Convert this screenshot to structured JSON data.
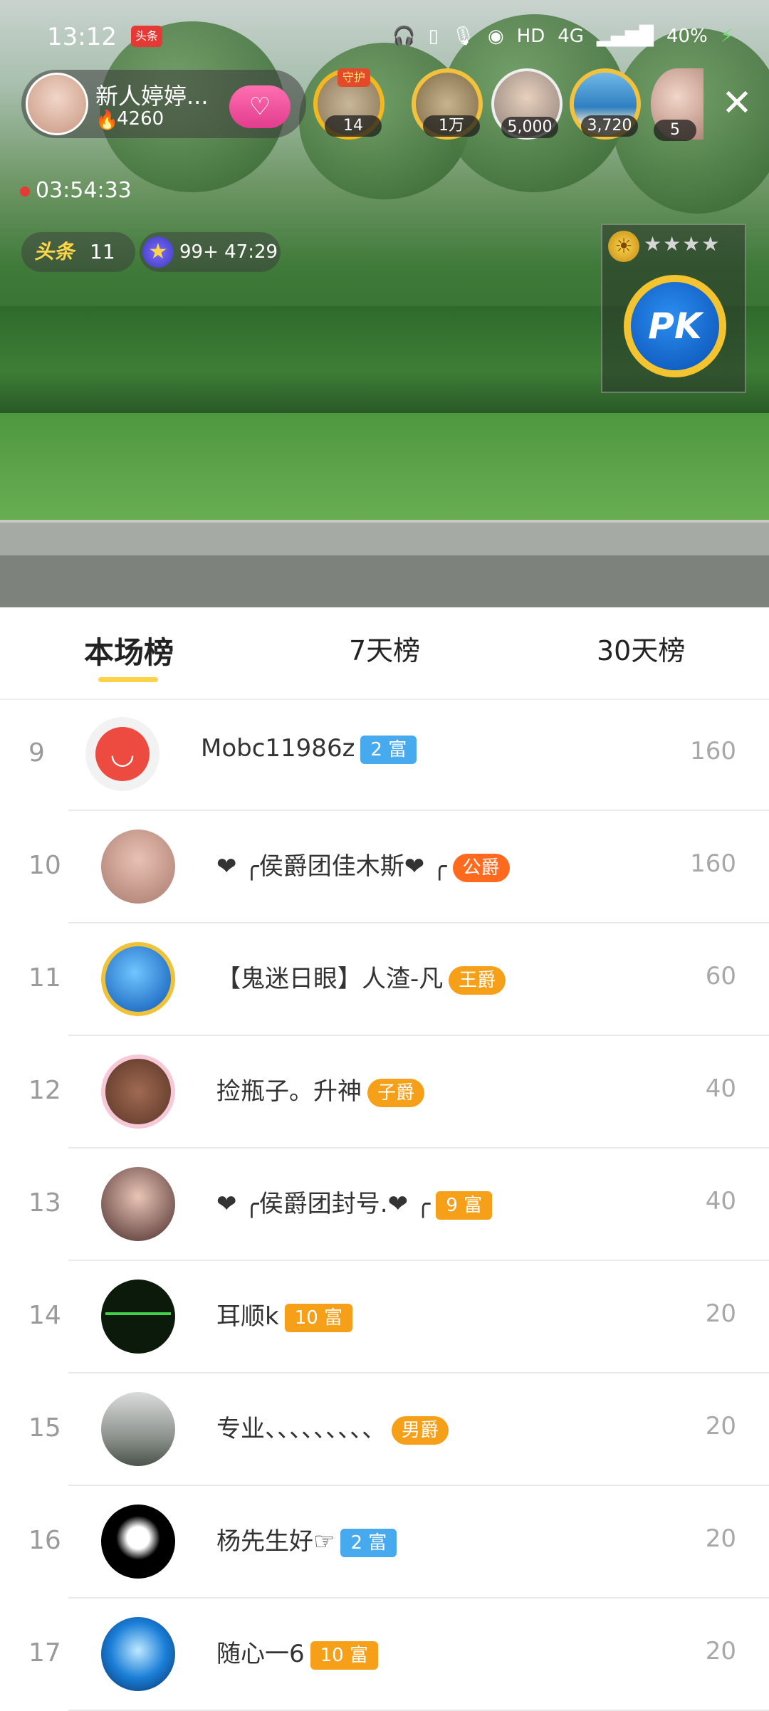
{
  "status_bar": {
    "time": "13:12",
    "news_badge": "头条",
    "network": "HD",
    "signal": "4G",
    "battery": "40%"
  },
  "host": {
    "name": "新人婷婷...",
    "score": "4260"
  },
  "viewers": [
    {
      "count": "14",
      "tag": "守护"
    },
    {
      "count": "1万"
    },
    {
      "count": "5,000"
    },
    {
      "count": "3,720"
    },
    {
      "count": "5"
    }
  ],
  "live": {
    "duration": "03:54:33"
  },
  "headline_rank": {
    "logo": "头条",
    "value": "11"
  },
  "star_info": {
    "text": "99+ 47:29"
  },
  "pk": {
    "label": "PK",
    "stars": "★★★★"
  },
  "tabs": [
    {
      "label": "本场榜",
      "active": true
    },
    {
      "label": "7天榜",
      "active": false
    },
    {
      "label": "30天榜",
      "active": false
    }
  ],
  "ranking": [
    {
      "rank": "9",
      "name": "Mobc11986z",
      "badge": "2 富",
      "badge_type": "blue",
      "score": "160"
    },
    {
      "rank": "10",
      "name": "❤ ╭侯爵团佳木斯❤ ╭",
      "badge": "公爵",
      "badge_type": "orange",
      "score": "160"
    },
    {
      "rank": "11",
      "name": "【鬼迷日眼】人渣-凡",
      "badge": "王爵",
      "badge_type": "crown",
      "score": "60"
    },
    {
      "rank": "12",
      "name": "捡瓶子。升神",
      "badge": "子爵",
      "badge_type": "crown",
      "score": "40"
    },
    {
      "rank": "13",
      "name": "❤ ╭侯爵团封号.❤ ╭",
      "badge": "9 富",
      "badge_type": "gold",
      "score": "40"
    },
    {
      "rank": "14",
      "name": "耳顺k",
      "badge": "10 富",
      "badge_type": "gold",
      "score": "20"
    },
    {
      "rank": "15",
      "name": "专业、、、、、、、、、",
      "badge": "男爵",
      "badge_type": "crown",
      "score": "20"
    },
    {
      "rank": "16",
      "name": "杨先生好☞",
      "badge": "2 富",
      "badge_type": "blue",
      "score": "20"
    },
    {
      "rank": "17",
      "name": "随心一6",
      "badge": "10 富",
      "badge_type": "gold",
      "score": "20"
    }
  ]
}
